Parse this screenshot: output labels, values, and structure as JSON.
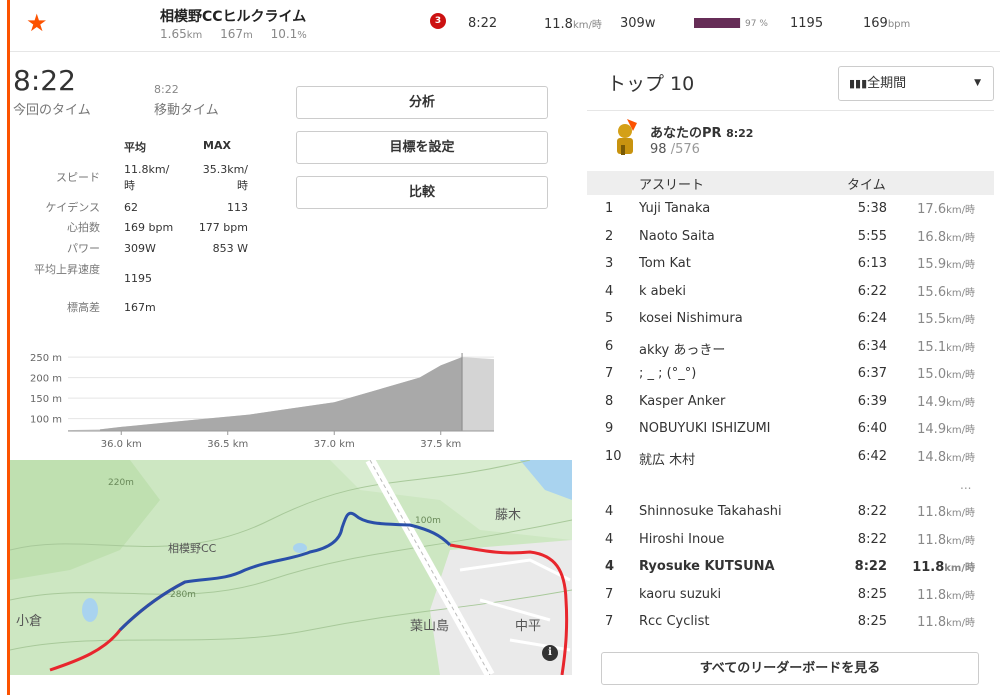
{
  "header": {
    "segment_name": "相模野CCヒルクライム",
    "distance": "1.65",
    "distance_unit": "km",
    "elev_gain": "167",
    "elev_unit": "m",
    "grade": "10.1",
    "grade_unit": "%",
    "rank_badge": "3",
    "time": "8:22",
    "speed": "11.8",
    "speed_unit": "km/時",
    "power": "309w",
    "percent": "97 %",
    "percent_value": 0.97,
    "power_rank": "1195",
    "heart_rate": "169",
    "hr_unit": "bpm"
  },
  "summary": {
    "elapsed_time": "8:22",
    "elapsed_label": "今回のタイム",
    "moving_time": "8:22",
    "moving_label": "移動タイム"
  },
  "buttons": {
    "analyze": "分析",
    "set_goal": "目標を設定",
    "compare": "比較"
  },
  "stats": {
    "col_avg": "平均",
    "col_max": "MAX",
    "rows": [
      {
        "label": "スピード",
        "avg": "11.8km/時",
        "max": "35.3km/時"
      },
      {
        "label": "ケイデンス",
        "avg": "62",
        "max": "113"
      },
      {
        "label": "心拍数",
        "avg": "169 bpm",
        "max": "177 bpm"
      },
      {
        "label": "パワー",
        "avg": "309W",
        "max": "853 W"
      },
      {
        "label": "平均上昇速度",
        "avg": "1195",
        "max": ""
      },
      {
        "label": "標高差",
        "avg": "167m",
        "max": ""
      }
    ]
  },
  "chart_data": {
    "type": "area",
    "title": "",
    "xlabel": "",
    "ylabel": "",
    "x_ticks": [
      "36.0 km",
      "36.5 km",
      "37.0 km",
      "37.5 km"
    ],
    "y_ticks": [
      "250 m",
      "200 m",
      "150 m",
      "100 m"
    ],
    "ylim": [
      70,
      260
    ],
    "xlim": [
      35.75,
      37.75
    ],
    "series": [
      {
        "x": [
          35.75,
          35.9,
          36.0,
          36.2,
          36.4,
          36.6,
          36.8,
          37.0,
          37.2,
          37.4,
          37.5,
          37.6,
          37.75
        ],
        "values": [
          72,
          74,
          80,
          90,
          100,
          110,
          125,
          140,
          170,
          200,
          230,
          250,
          245
        ]
      }
    ],
    "highlight_range": [
      35.9,
      37.6
    ],
    "grid": true
  },
  "map": {
    "labels": [
      "相模野CC",
      "小倉",
      "藤木",
      "葉山島",
      "中平",
      "220m",
      "100m",
      "280m"
    ]
  },
  "leaderboard": {
    "title": "トップ 10",
    "period": "全期間",
    "pr_label": "あなたのPR",
    "pr_time": "8:22",
    "pr_rank": "98",
    "pr_total": "/576",
    "col_athlete": "アスリート",
    "col_time": "タイム",
    "top": [
      {
        "rank": "1",
        "name": "Yuji Tanaka",
        "time": "5:38",
        "speed": "17.6"
      },
      {
        "rank": "2",
        "name": "Naoto Saita",
        "time": "5:55",
        "speed": "16.8"
      },
      {
        "rank": "3",
        "name": "Tom Kat",
        "time": "6:13",
        "speed": "15.9"
      },
      {
        "rank": "4",
        "name": "k abeki",
        "time": "6:22",
        "speed": "15.6"
      },
      {
        "rank": "5",
        "name": "kosei Nishimura",
        "time": "6:24",
        "speed": "15.5"
      },
      {
        "rank": "6",
        "name": "akky あっきー",
        "time": "6:34",
        "speed": "15.1"
      },
      {
        "rank": "7",
        "name": "; _ ; (°_°)",
        "time": "6:37",
        "speed": "15.0"
      },
      {
        "rank": "8",
        "name": "Kasper Anker",
        "time": "6:39",
        "speed": "14.9"
      },
      {
        "rank": "9",
        "name": "NOBUYUKI ISHIZUMI",
        "time": "6:40",
        "speed": "14.9"
      },
      {
        "rank": "10",
        "name": "就広 木村",
        "time": "6:42",
        "speed": "14.8"
      }
    ],
    "ellipsis": "...",
    "nearby": [
      {
        "rank": "4",
        "name": "Shinnosuke Takahashi",
        "time": "8:22",
        "speed": "11.8"
      },
      {
        "rank": "4",
        "name": "Hiroshi Inoue",
        "time": "8:22",
        "speed": "11.8"
      },
      {
        "rank": "4",
        "name": "Ryosuke KUTSUNA",
        "time": "8:22",
        "speed": "11.8",
        "me": true
      },
      {
        "rank": "7",
        "name": "kaoru suzuki",
        "time": "8:25",
        "speed": "11.8"
      },
      {
        "rank": "7",
        "name": "Rcc Cyclist",
        "time": "8:25",
        "speed": "11.8"
      }
    ],
    "speed_unit": "km/時",
    "view_all": "すべてのリーダーボードを見る"
  },
  "colors": {
    "accent": "#fc5200",
    "power_bar": "#662d57",
    "route_blue": "#2a4fa8",
    "route_red": "#e8262d"
  }
}
